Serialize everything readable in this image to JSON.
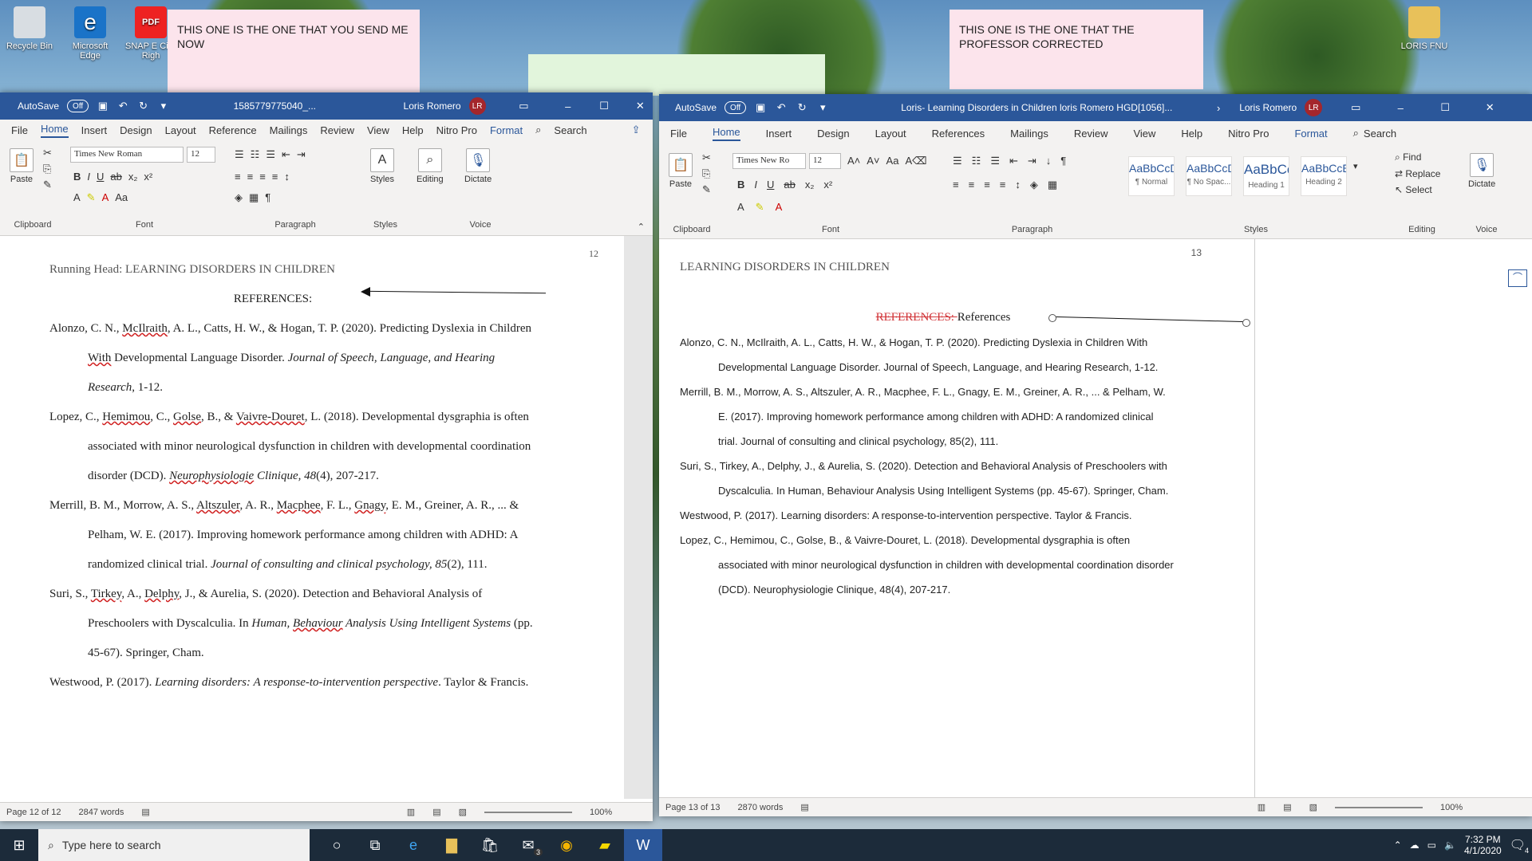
{
  "desktop": {
    "icons": [
      {
        "label": "Recycle Bin"
      },
      {
        "label": "Microsoft Edge"
      },
      {
        "label": "SNAP E Civil Righ"
      },
      {
        "label": "LORIS FNU"
      }
    ],
    "stickies": [
      {
        "text": "THIS ONE IS THE ONE THAT YOU SEND ME NOW"
      },
      {
        "text": "THIS ONE IS THE ONE THAT THE PROFESSOR CORRECTED"
      }
    ]
  },
  "left_window": {
    "autosave": "AutoSave",
    "autosave_state": "Off",
    "title": "1585779775040_...",
    "user": "Loris Romero",
    "initials": "LR",
    "tabs": [
      "File",
      "Home",
      "Insert",
      "Design",
      "Layout",
      "Reference",
      "Mailings",
      "Review",
      "View",
      "Help",
      "Nitro Pro",
      "Format"
    ],
    "search": "Search",
    "font": "Times New Roman",
    "size": "12",
    "groups": {
      "clipboard": "Clipboard",
      "font": "Font",
      "paragraph": "Paragraph",
      "styles": "Styles",
      "voice": "Voice"
    },
    "buttons": {
      "paste": "Paste",
      "styles": "Styles",
      "editing": "Editing",
      "dictate": "Dictate"
    },
    "page_number": "12",
    "running_head": "Running Head: LEARNING DISORDERS IN CHILDREN",
    "heading": "REFERENCES:",
    "refs": [
      [
        "Alonzo, C. N., ",
        "McIlraith",
        ", A. L., Catts, H. W., & Hogan, T. P. (2020). Predicting Dyslexia in Children ",
        "With",
        " Developmental Language Disorder. ",
        "Journal of Speech, Language, and Hearing Research",
        ", 1-12."
      ],
      [
        "Lopez, C., ",
        "Hemimou",
        ", C., ",
        "Golse",
        ", B., & ",
        "Vaivre-Douret",
        ", L. (2018). Developmental dysgraphia is often associated with minor neurological dysfunction in children with developmental coordination disorder (DCD). ",
        "Neurophysiologie",
        " Clinique, 48",
        "(4), 207-217."
      ],
      [
        "Merrill, B. M., Morrow, A. S., ",
        "Altszuler",
        ", A. R., ",
        "Macphee",
        ", F. L., ",
        "Gnagy",
        ", E. M., Greiner, A. R., ... & Pelham, W. E. (2017). Improving homework performance among children with ADHD: A randomized clinical trial. ",
        "Journal of consulting and clinical psychology, 85",
        "(2), 111."
      ],
      [
        "Suri, S., ",
        "Tirkey",
        ", A., ",
        "Delphy",
        ", J., & Aurelia, S. (2020). Detection and Behavioral Analysis of Preschoolers with Dyscalculia. In ",
        "Human, ",
        "Behaviour",
        " Analysis Using Intelligent Systems",
        " (pp. 45-67). Springer, Cham."
      ],
      [
        "Westwood, P. (2017). ",
        "Learning disorders: A response-to-intervention perspective",
        ". Taylor & Francis."
      ]
    ],
    "status": {
      "page": "Page 12 of 12",
      "words": "2847 words",
      "zoom": "100%"
    }
  },
  "right_window": {
    "autosave": "AutoSave",
    "autosave_state": "Off",
    "title": "Loris- Learning Disorders in Children loris Romero HGD[1056]...",
    "user": "Loris Romero",
    "initials": "LR",
    "tabs": [
      "File",
      "Home",
      "Insert",
      "Design",
      "Layout",
      "References",
      "Mailings",
      "Review",
      "View",
      "Help",
      "Nitro Pro",
      "Format"
    ],
    "search": "Search",
    "font": "Times New Ro",
    "size": "12",
    "styles": [
      {
        "preview": "AaBbCcDc",
        "name": "¶ Normal"
      },
      {
        "preview": "AaBbCcDc",
        "name": "¶ No Spac..."
      },
      {
        "preview": "AaBbCc",
        "name": "Heading 1"
      },
      {
        "preview": "AaBbCcE",
        "name": "Heading 2"
      }
    ],
    "editing": {
      "find": "Find",
      "replace": "Replace",
      "select": "Select"
    },
    "groups": {
      "clipboard": "Clipboard",
      "font": "Font",
      "paragraph": "Paragraph",
      "styles": "Styles",
      "editing": "Editing",
      "voice": "Voice"
    },
    "buttons": {
      "paste": "Paste",
      "dictate": "Dictate"
    },
    "page_number": "13",
    "running_head": "LEARNING DISORDERS IN CHILDREN",
    "heading_deleted": "REFERENCES: ",
    "heading": "References",
    "refs": [
      "Alonzo, C. N., McIlraith, A. L., Catts, H. W., & Hogan, T. P. (2020). Predicting Dyslexia in Children With Developmental Language Disorder. Journal of Speech, Language, and Hearing Research, 1-12.",
      "Merrill, B. M., Morrow, A. S., Altszuler, A. R., Macphee, F. L., Gnagy, E. M., Greiner, A. R., ... & Pelham, W. E. (2017). Improving homework performance among children with ADHD: A randomized clinical trial. Journal of consulting and clinical psychology, 85(2), 111.",
      "Suri, S., Tirkey, A., Delphy, J., & Aurelia, S. (2020). Detection and Behavioral Analysis of Preschoolers with Dyscalculia. In Human, Behaviour Analysis Using Intelligent Systems (pp. 45-67). Springer, Cham.",
      "Westwood, P. (2017). Learning disorders: A response-to-intervention perspective. Taylor & Francis.",
      "Lopez, C., Hemimou, C., Golse, B., & Vaivre-Douret, L. (2018). Developmental dysgraphia is often associated with minor neurological dysfunction in children with developmental coordination disorder (DCD). Neurophysiologie Clinique, 48(4), 207-217."
    ],
    "status": {
      "page": "Page 13 of 13",
      "words": "2870 words",
      "zoom": "100%"
    }
  },
  "taskbar": {
    "search_placeholder": "Type here to search",
    "mail_badge": "3",
    "time": "7:32 PM",
    "date": "4/1/2020",
    "notif_count": "4"
  },
  "colors": {
    "word_blue": "#2b579a",
    "sticky_pink": "#fce4ec",
    "sticky_green": "#e2f5dc",
    "avatar": "#a4262c"
  }
}
